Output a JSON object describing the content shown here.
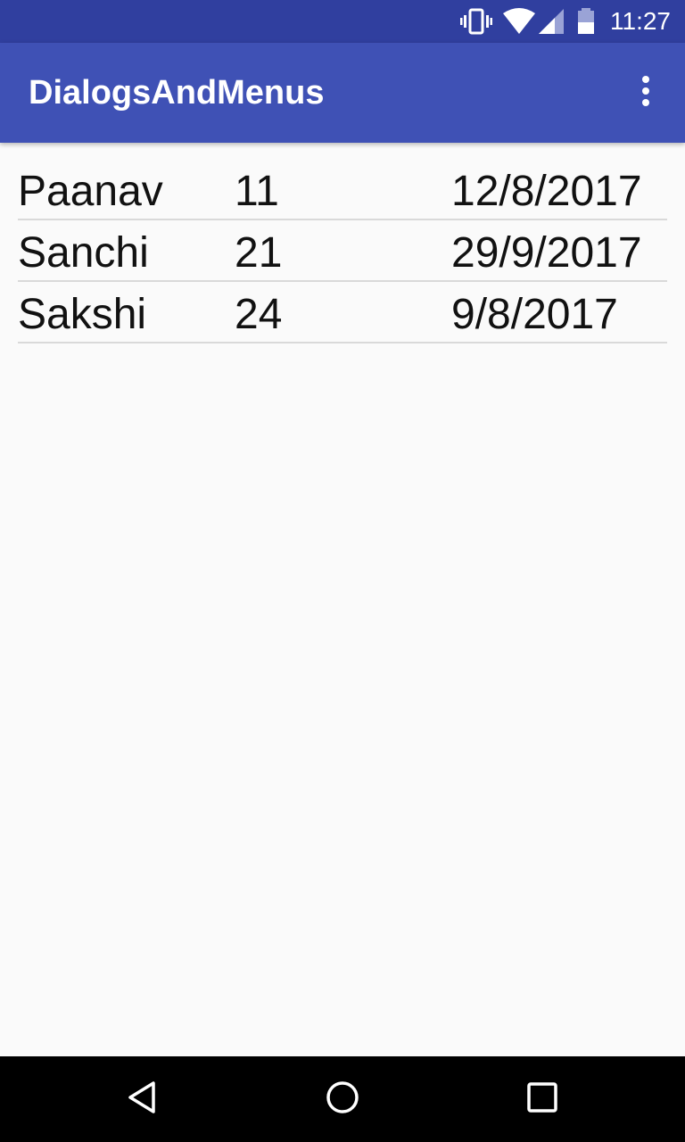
{
  "status_bar": {
    "time": "11:27",
    "icons": [
      "vibrate-icon",
      "wifi-icon",
      "signal-icon",
      "battery-icon"
    ]
  },
  "app_bar": {
    "title": "DialogsAndMenus",
    "overflow_icon": "more-vert-icon"
  },
  "list": {
    "rows": [
      {
        "name": "Paanav",
        "age": "11",
        "date": "12/8/2017"
      },
      {
        "name": "Sanchi",
        "age": "21",
        "date": "29/9/2017"
      },
      {
        "name": "Sakshi",
        "age": "24",
        "date": "9/8/2017"
      }
    ]
  },
  "nav_bar": {
    "icons": [
      "back-icon",
      "home-icon",
      "recents-icon"
    ]
  },
  "colors": {
    "status_bar": "#303f9f",
    "app_bar": "#3f51b5",
    "background": "#fafafa",
    "divider": "#d9d9d9",
    "nav_bar": "#000000"
  }
}
